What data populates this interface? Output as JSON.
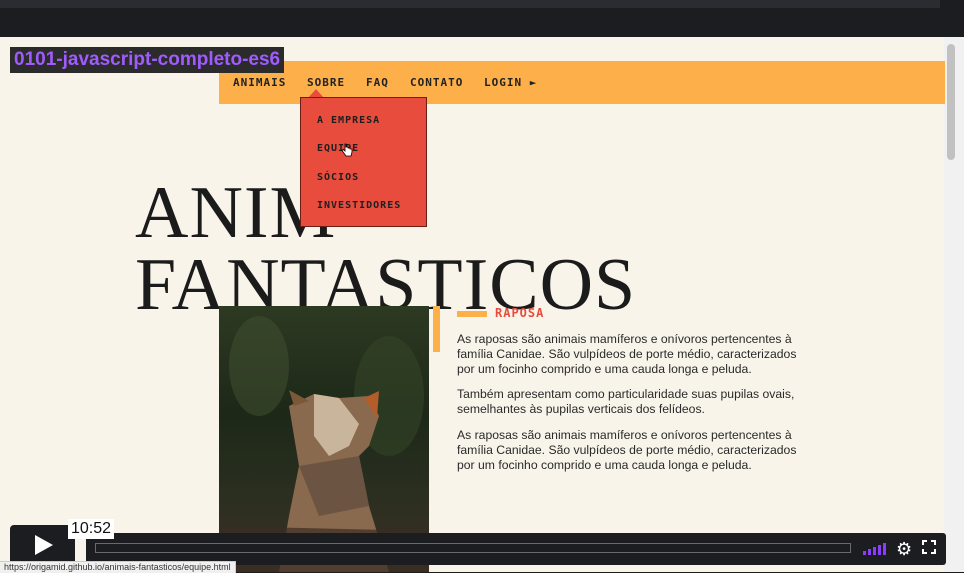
{
  "video": {
    "title": "0101-javascript-completo-es6",
    "timecode": "10:52"
  },
  "site": {
    "menu": [
      "ANIMAIS",
      "SOBRE",
      "FAQ",
      "CONTATO",
      "LOGIN ►"
    ],
    "dropdown": [
      "A EMPRESA",
      "EQUIPE",
      "SÓCIOS",
      "INVESTIDORES"
    ],
    "hero_line1": "ANIM",
    "hero_line2": "FANTASTICOS",
    "section_title": "RAPOSA",
    "paragraphs": [
      "As raposas são animais mamíferos e onívoros pertencentes à família Canidae. São vulpídeos de porte médio, caracterizados por um focinho comprido e uma cauda longa e peluda.",
      "Também apresentam como particularidade suas pupilas ovais, semelhantes às pupilas verticais dos felídeos.",
      "As raposas são animais mamíferos e onívoros pertencentes à família Canidae. São vulpídeos de porte médio, caracterizados por um focinho comprido e uma cauda longa e peluda."
    ]
  },
  "status_url": "https://origamid.github.io/animais-fantasticos/equipe.html",
  "colors": {
    "accent": "#fdb04a",
    "dropdown": "#e84c3d",
    "title_purple": "#a05bff",
    "page_bg": "#f8f4ea"
  },
  "icons": [
    "play-icon",
    "volume-icon",
    "gear-icon",
    "fullscreen-icon",
    "hand-cursor-icon"
  ]
}
